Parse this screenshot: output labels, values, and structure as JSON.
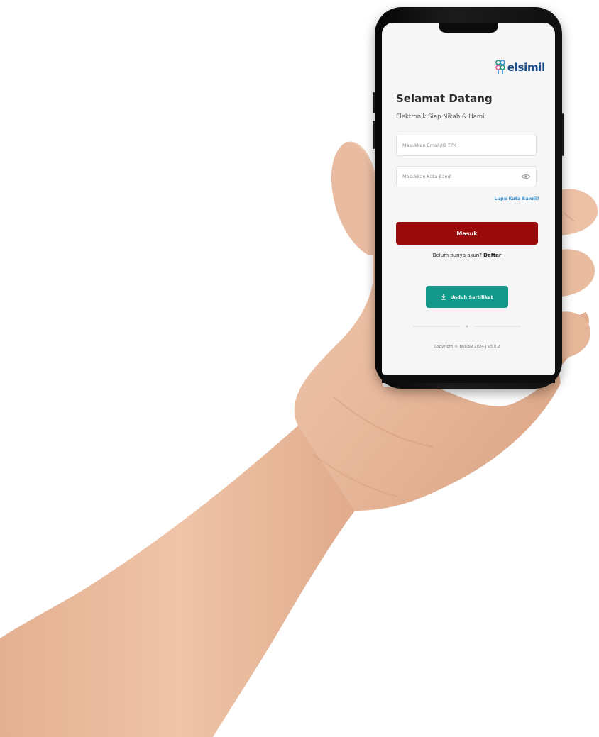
{
  "app": {
    "brand": "elsimil",
    "colors": {
      "primary_button": "#9b0a0a",
      "secondary_button": "#13988a",
      "link": "#2a8fd6",
      "brand_text": "#1e4d8c",
      "screen_background": "#f6f6f6"
    }
  },
  "login": {
    "title": "Selamat Datang",
    "subtitle": "Elektronik Siap Nikah & Hamil",
    "email_placeholder": "Masukkan Email/ID TPK",
    "password_placeholder": "Masukkan Kata Sandi",
    "password_toggle_icon": "eye-icon",
    "forgot_password": "Lupa Kata Sandi?",
    "login_button": "Masuk",
    "no_account_text": "Belum punya akun?",
    "register_link": "Daftar"
  },
  "certificate": {
    "button_label": "Unduh Sertifikat",
    "icon": "download-icon"
  },
  "footer": {
    "copyright": "Copyright © BKKBN 2024 | v3.0.2"
  }
}
